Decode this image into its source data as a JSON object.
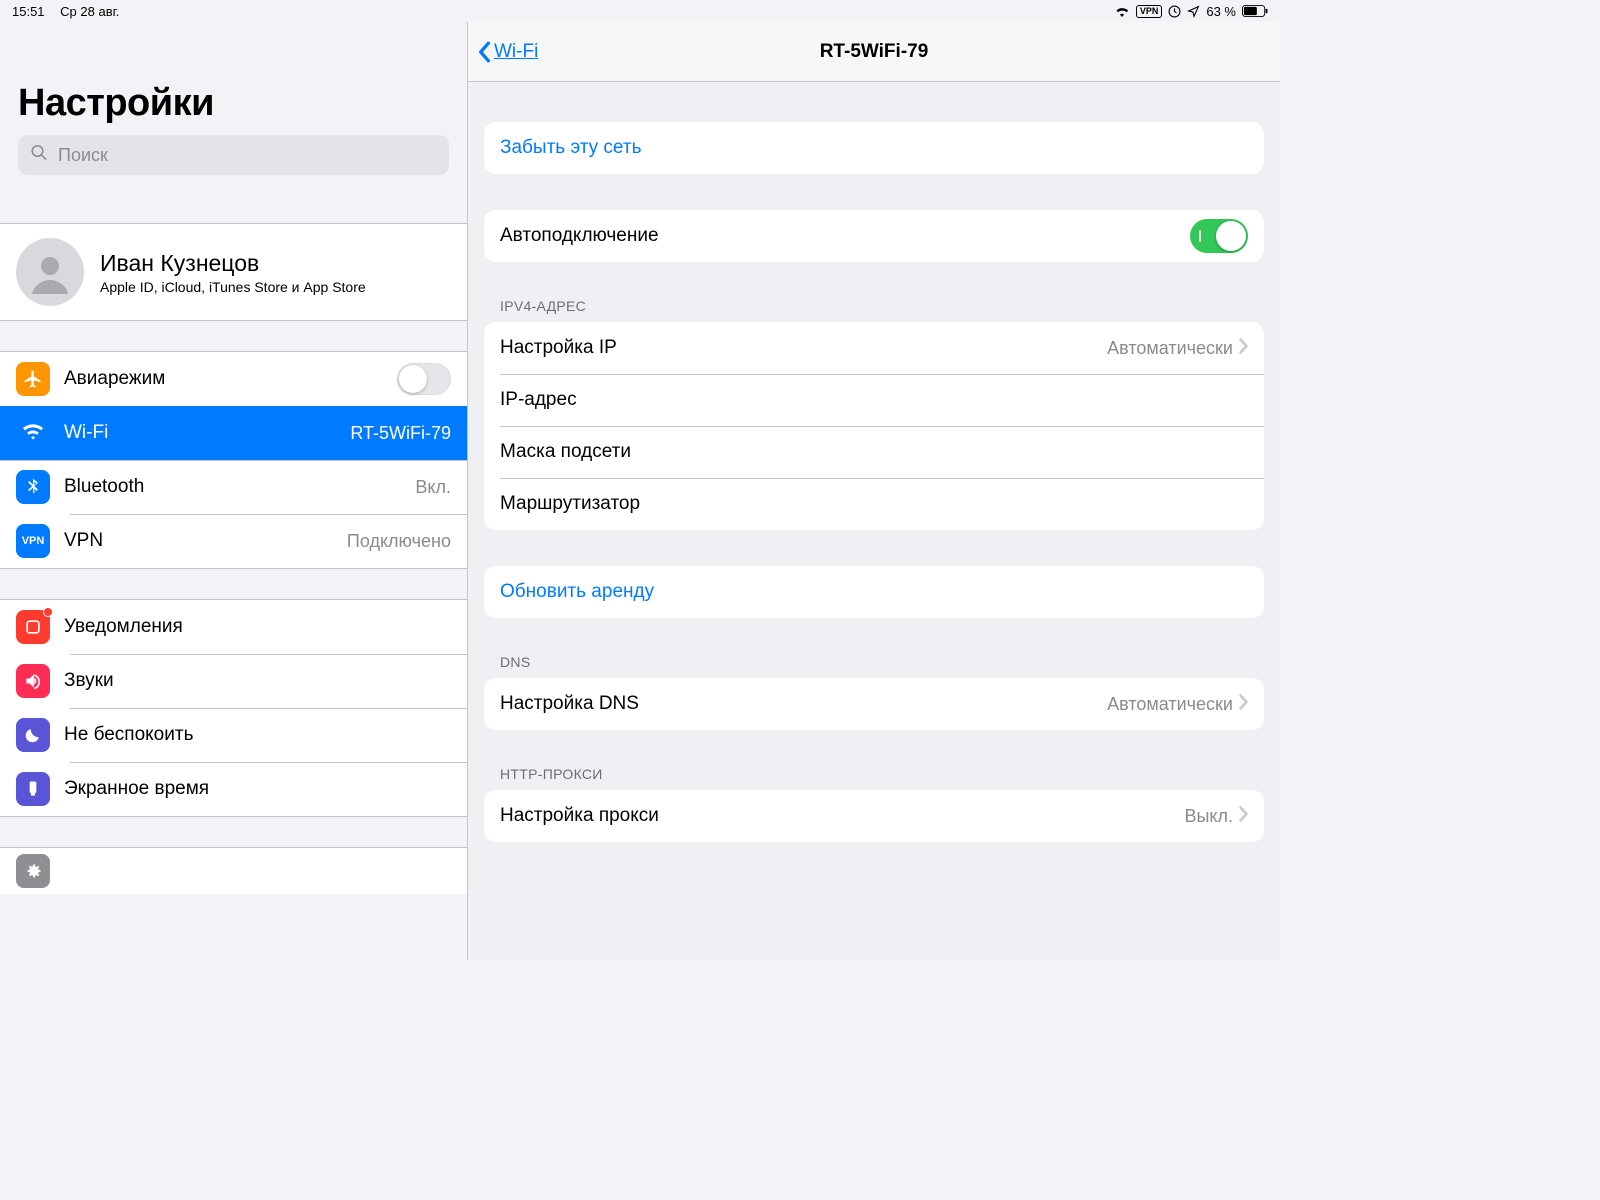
{
  "statusbar": {
    "time": "15:51",
    "date": "Ср 28 авг.",
    "vpn_label": "VPN",
    "battery_pct": "63 %"
  },
  "sidebar": {
    "title": "Настройки",
    "search_placeholder": "Поиск",
    "profile": {
      "name": "Иван Кузнецов",
      "sub": "Apple ID, iCloud, iTunes Store и App Store"
    },
    "group_net": {
      "airplane": "Авиарежим",
      "wifi": "Wi-Fi",
      "wifi_value": "RT-5WiFi-79",
      "bluetooth": "Bluetooth",
      "bluetooth_value": "Вкл.",
      "vpn": "VPN",
      "vpn_value": "Подключено"
    },
    "group_notif": {
      "notifications": "Уведомления",
      "sounds": "Звуки",
      "dnd": "Не беспокоить",
      "screentime": "Экранное время"
    }
  },
  "detail": {
    "back_label": "Wi-Fi",
    "title": "RT-5WiFi-79",
    "forget": "Забыть эту сеть",
    "autojoin": "Автоподключение",
    "sections": {
      "ipv4_label": "IPV4-АДРЕС",
      "configure_ip": "Настройка IP",
      "configure_ip_value": "Автоматически",
      "ip_address": "IP-адрес",
      "subnet": "Маска подсети",
      "router": "Маршрутизатор",
      "renew_lease": "Обновить аренду",
      "dns_label": "DNS",
      "configure_dns": "Настройка DNS",
      "configure_dns_value": "Автоматически",
      "proxy_label": "HTTP-ПРОКСИ",
      "configure_proxy": "Настройка прокси",
      "configure_proxy_value": "Выкл."
    }
  }
}
